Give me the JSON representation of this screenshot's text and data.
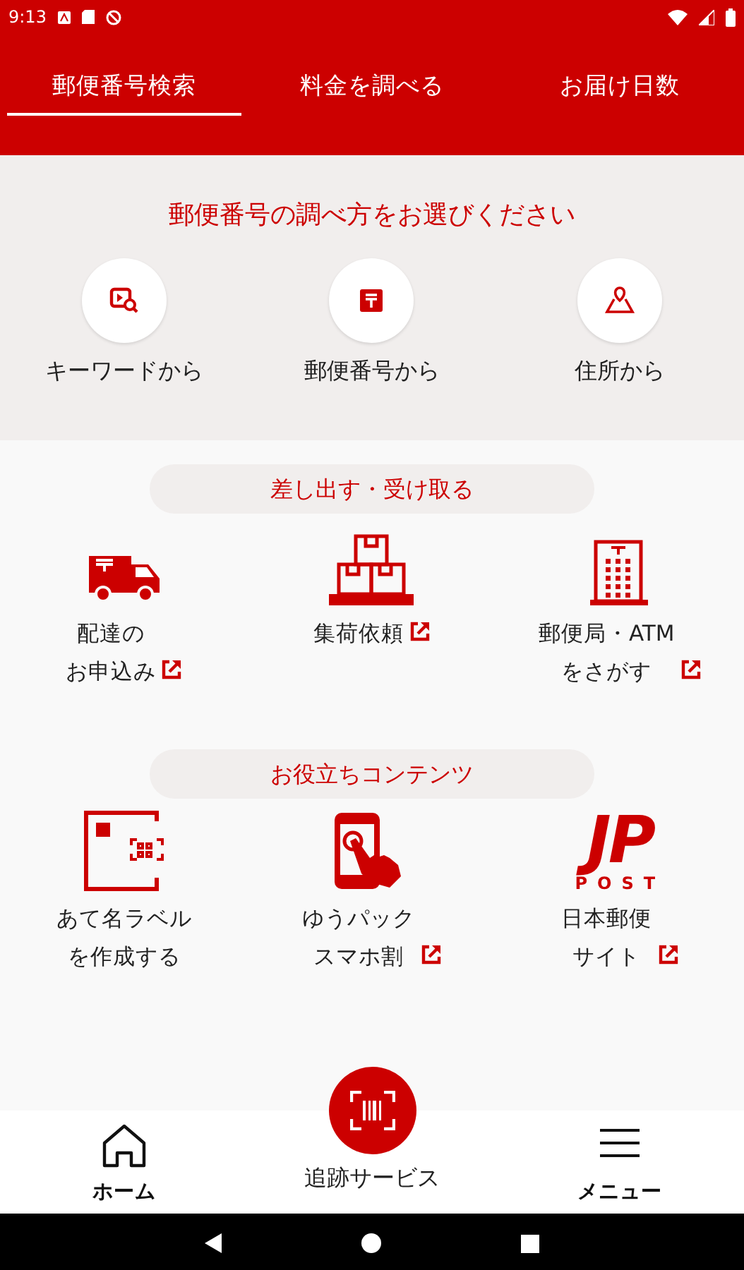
{
  "status_bar": {
    "time": "9:13"
  },
  "tabs": [
    {
      "label": "郵便番号検索",
      "selected": true
    },
    {
      "label": "料金を調べる",
      "selected": false
    },
    {
      "label": "お届け日数",
      "selected": false
    }
  ],
  "search_methods": {
    "title": "郵便番号の調べ方をお選びください",
    "options": [
      {
        "kind": "keyword",
        "label": "キーワードから"
      },
      {
        "kind": "postcode",
        "label": "郵便番号から"
      },
      {
        "kind": "address",
        "label": "住所から"
      }
    ]
  },
  "sections": [
    {
      "title": "差し出す・受け取る",
      "items": [
        {
          "kind": "truck",
          "lines": [
            "配達の",
            "お申込み"
          ],
          "external": true
        },
        {
          "kind": "boxes",
          "lines": [
            "集荷依頼"
          ],
          "external": true
        },
        {
          "kind": "building",
          "lines": [
            "郵便局・ATM",
            "をさがす"
          ],
          "external": true
        }
      ]
    },
    {
      "title": "お役立ちコンテンツ",
      "items": [
        {
          "kind": "label",
          "lines": [
            "あて名ラベル",
            "を作成する"
          ],
          "external": false
        },
        {
          "kind": "phone",
          "lines": [
            "ゆうパック",
            "スマホ割"
          ],
          "external": true
        },
        {
          "kind": "logo",
          "logo_text": "JP",
          "logo_subtext": "POST",
          "lines": [
            "日本郵便",
            "サイト"
          ],
          "external": true
        }
      ]
    }
  ],
  "bottom_nav": [
    {
      "kind": "home",
      "label": "ホーム"
    },
    {
      "kind": "scan",
      "label": "追跡サービス"
    },
    {
      "kind": "menu",
      "label": "メニュー"
    }
  ]
}
